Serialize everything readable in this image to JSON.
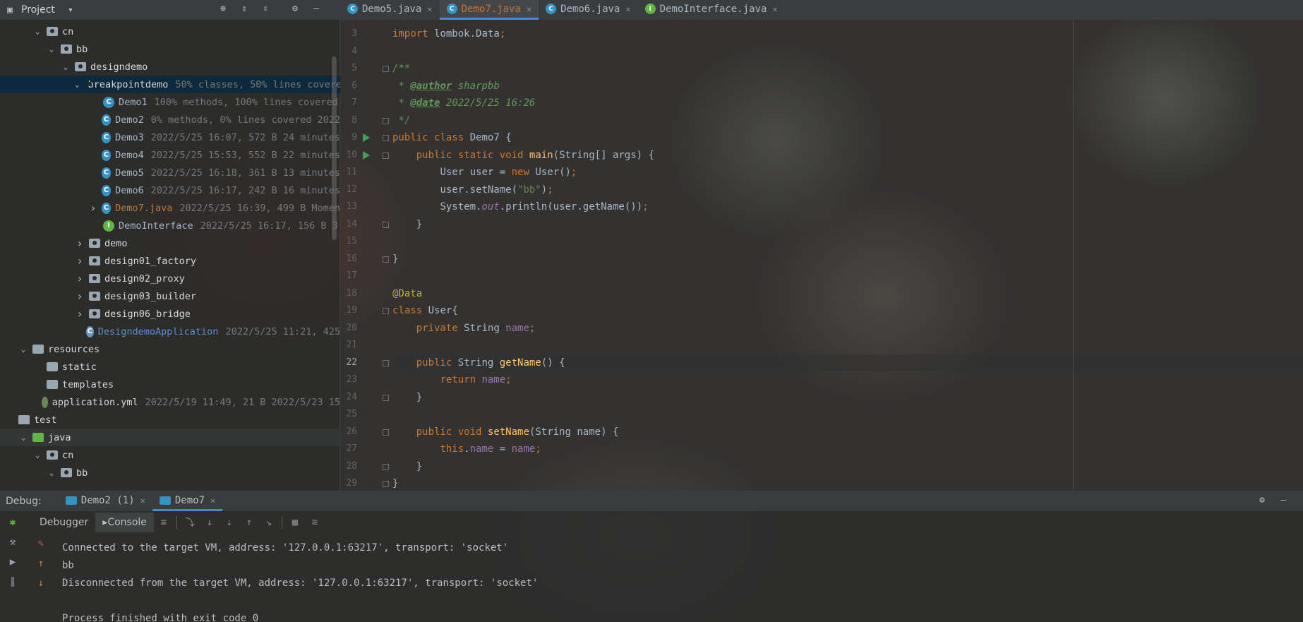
{
  "project_panel": {
    "title": "Project",
    "tree": [
      {
        "indent": 1,
        "chev": "v",
        "icon": "pkg",
        "label": "cn",
        "meta": "",
        "style": "white"
      },
      {
        "indent": 2,
        "chev": "v",
        "icon": "pkg",
        "label": "bb",
        "meta": "",
        "style": "white"
      },
      {
        "indent": 3,
        "chev": "v",
        "icon": "pkg",
        "label": "designdemo",
        "meta": "",
        "style": "white"
      },
      {
        "indent": 4,
        "chev": "v",
        "icon": "pkg",
        "label": "breakpointdemo",
        "meta": "50% classes, 50% lines covered",
        "style": "white",
        "selected": true
      },
      {
        "indent": 5,
        "chev": "",
        "icon": "class",
        "label": "Demo1",
        "meta": "100% methods, 100% lines covered",
        "style": "normal"
      },
      {
        "indent": 5,
        "chev": "",
        "icon": "class",
        "label": "Demo2",
        "meta": "0% methods, 0% lines covered  2022",
        "style": "normal"
      },
      {
        "indent": 5,
        "chev": "",
        "icon": "class",
        "label": "Demo3",
        "meta": "2022/5/25 16:07, 572 B 24 minutes",
        "style": "normal"
      },
      {
        "indent": 5,
        "chev": "",
        "icon": "class",
        "label": "Demo4",
        "meta": "2022/5/25 15:53, 552 B 22 minutes",
        "style": "normal"
      },
      {
        "indent": 5,
        "chev": "",
        "icon": "class",
        "label": "Demo5",
        "meta": "2022/5/25 16:18, 361 B 13 minutes",
        "style": "normal"
      },
      {
        "indent": 5,
        "chev": "",
        "icon": "class",
        "label": "Demo6",
        "meta": "2022/5/25 16:17, 242 B 16 minutes",
        "style": "normal"
      },
      {
        "indent": 5,
        "chev": ">",
        "icon": "class",
        "label": "Demo7.java",
        "meta": "2022/5/25 16:39, 499 B Momen",
        "style": "orange"
      },
      {
        "indent": 5,
        "chev": "",
        "icon": "iface",
        "label": "DemoInterface",
        "meta": "2022/5/25 16:17, 156 B 3",
        "style": "normal"
      },
      {
        "indent": 4,
        "chev": ">",
        "icon": "pkg",
        "label": "demo",
        "meta": "",
        "style": "white"
      },
      {
        "indent": 4,
        "chev": ">",
        "icon": "pkg",
        "label": "design01_factory",
        "meta": "",
        "style": "white"
      },
      {
        "indent": 4,
        "chev": ">",
        "icon": "pkg",
        "label": "design02_proxy",
        "meta": "",
        "style": "white"
      },
      {
        "indent": 4,
        "chev": ">",
        "icon": "pkg",
        "label": "design03_builder",
        "meta": "",
        "style": "white"
      },
      {
        "indent": 4,
        "chev": ">",
        "icon": "pkg",
        "label": "design06_bridge",
        "meta": "",
        "style": "white"
      },
      {
        "indent": 4,
        "chev": "",
        "icon": "spring",
        "label": "DesigndemoApplication",
        "meta": "2022/5/25 11:21, 425",
        "style": "blue"
      },
      {
        "indent": 0,
        "chev": "v",
        "icon": "res",
        "label": "resources",
        "meta": "",
        "style": "white"
      },
      {
        "indent": 1,
        "chev": "",
        "icon": "folder",
        "label": "static",
        "meta": "",
        "style": "white"
      },
      {
        "indent": 1,
        "chev": "",
        "icon": "folder",
        "label": "templates",
        "meta": "",
        "style": "white"
      },
      {
        "indent": 1,
        "chev": "",
        "icon": "yml",
        "label": "application.yml",
        "meta": "2022/5/19 11:49, 21 B 2022/5/23 15",
        "style": "white"
      },
      {
        "indent": -1,
        "chev": "",
        "icon": "folder",
        "label": "test",
        "meta": "",
        "style": "white"
      },
      {
        "indent": 0,
        "chev": "v",
        "icon": "green",
        "label": "java",
        "meta": "",
        "style": "white",
        "hover": true
      },
      {
        "indent": 1,
        "chev": "v",
        "icon": "pkg",
        "label": "cn",
        "meta": "",
        "style": "white"
      },
      {
        "indent": 2,
        "chev": "v",
        "icon": "pkg",
        "label": "bb",
        "meta": "",
        "style": "white"
      }
    ]
  },
  "editor_tabs": [
    {
      "label": "Demo5.java",
      "active": false
    },
    {
      "label": "Demo7.java",
      "active": true
    },
    {
      "label": "Demo6.java",
      "active": false
    },
    {
      "label": "DemoInterface.java",
      "active": false,
      "icon": "interface"
    }
  ],
  "code": {
    "first_line_number": 3,
    "current_line": 22,
    "run_lines": [
      9,
      10
    ],
    "lines": [
      "import lombok.Data;",
      "",
      "/**",
      " * @author sharpbb",
      " * @date 2022/5/25 16:26",
      " */",
      "public class Demo7 {",
      "    public static void main(String[] args) {",
      "        User user = new User();",
      "        user.setName(\"bb\");",
      "        System.out.println(user.getName());",
      "    }",
      "",
      "}",
      "",
      "@Data",
      "class User{",
      "    private String name;",
      "",
      "    public String getName() {",
      "        return name;",
      "    }",
      "",
      "    public void setName(String name) {",
      "        this.name = name;",
      "    }",
      "}"
    ]
  },
  "debug": {
    "title": "Debug:",
    "tabs": [
      {
        "label": "Demo2 (1)",
        "active": false
      },
      {
        "label": "Demo7",
        "active": true
      }
    ],
    "subtabs": [
      "Debugger",
      "Console"
    ],
    "console_lines": [
      "Connected to the target VM, address: '127.0.0.1:63217', transport: 'socket'",
      "bb",
      "Disconnected from the target VM, address: '127.0.0.1:63217', transport: 'socket'",
      "",
      "Process finished with exit code 0"
    ]
  },
  "colors": {
    "keyword": "#cc7832",
    "string": "#6a8759",
    "comment": "#629755",
    "annotation": "#bbb529",
    "method": "#ffc66d",
    "field": "#9876aa",
    "active_tab": "#c57533",
    "selection": "#0d293e"
  }
}
